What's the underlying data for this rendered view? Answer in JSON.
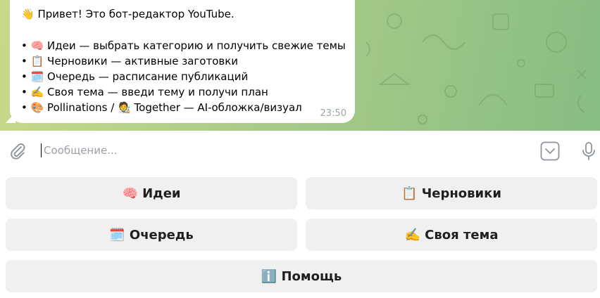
{
  "message": {
    "lines": [
      "👋 Привет! Это бот-редактор YouTube.",
      "• 🧠 Идеи — выбрать категорию и получить свежие темы",
      "• 📋 Черновики — активные заготовки",
      "• 🗓️ Очередь — расписание публикаций",
      "• ✍️ Своя тема — введи тему и получи план",
      "• 🎨 Pollinations / 🧑‍🎨 Together — AI-обложка/визуал"
    ],
    "time": "23:50"
  },
  "composer": {
    "placeholder": "Сообщение..."
  },
  "icons": {
    "attach": "paperclip-icon",
    "keyboard": "keyboard-toggle-icon",
    "mic": "microphone-icon"
  },
  "keyboard": {
    "ideas": "🧠 Идеи",
    "drafts": "📋 Черновики",
    "queue": "🗓️ Очередь",
    "own_topic": "✍️ Своя тема",
    "help": "ℹ️ Помощь"
  },
  "colors": {
    "chat_bg_start": "#c9d98a",
    "chat_bg_end": "#88bd84",
    "bubble": "#ffffff",
    "button_bg": "#f0f0f0",
    "timestamp": "#9aa3a8"
  }
}
